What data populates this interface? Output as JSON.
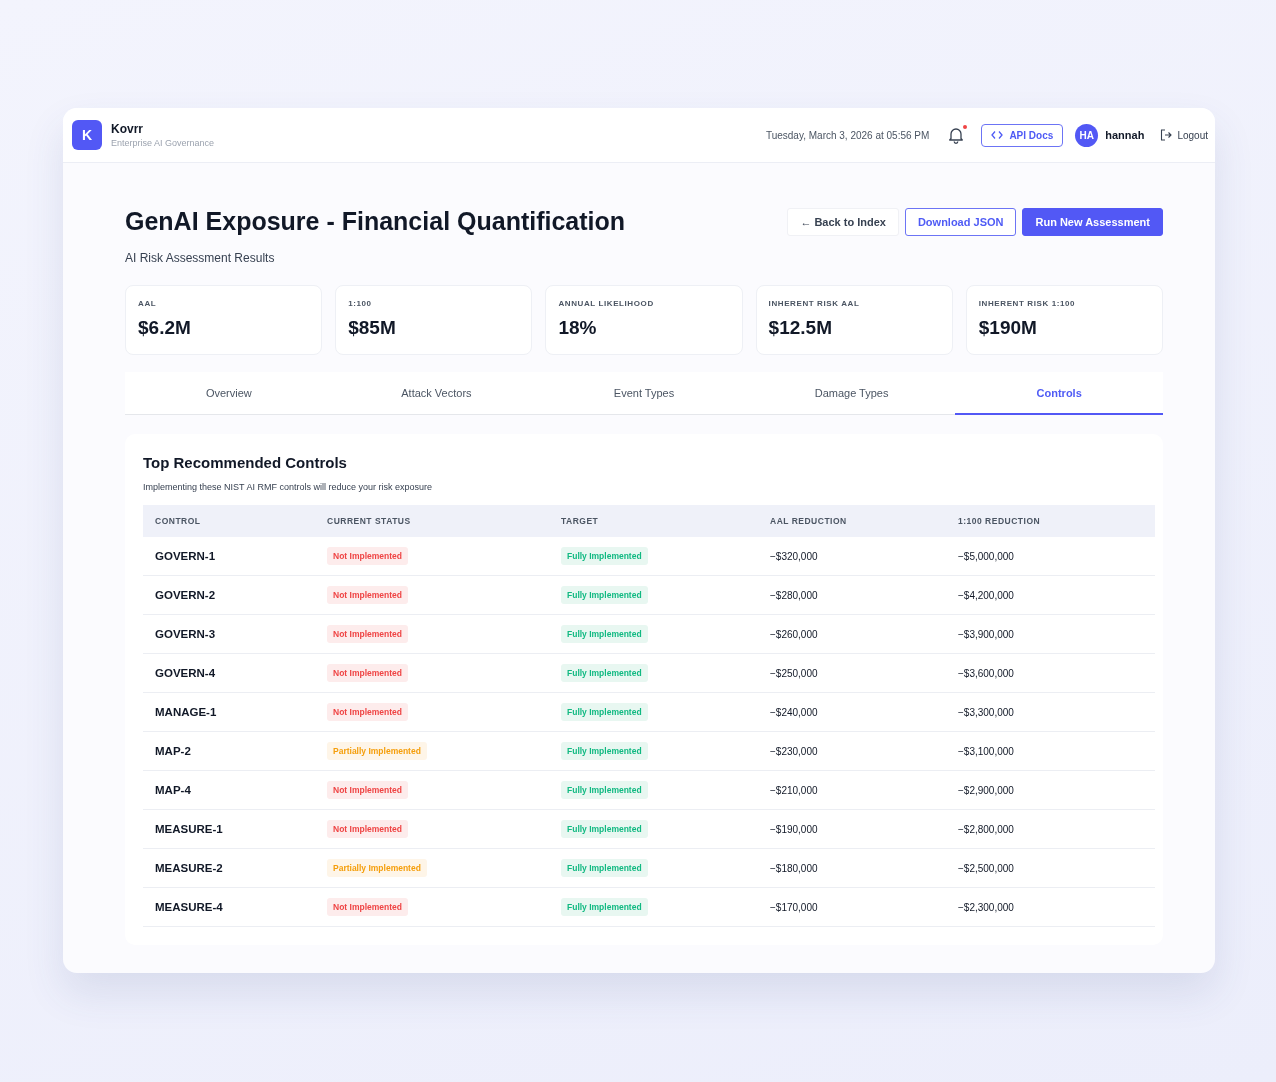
{
  "header": {
    "logo": "K",
    "app_name": "Kovrr",
    "subtitle": "Enterprise AI Governance",
    "datetime": "Tuesday, March 3, 2026 at 05:56 PM",
    "notification_unread": true,
    "api_docs": "API Docs",
    "user_initials": "HA",
    "user_name": "hannah",
    "logout": "Logout"
  },
  "page": {
    "title": "GenAI Exposure - Financial Quantification",
    "subtitle": "AI Risk Assessment Results",
    "buttons": [
      {
        "label": "Back to Index",
        "kind": "back",
        "icon": "←"
      },
      {
        "label": "Download JSON",
        "kind": "outline"
      },
      {
        "label": "Run New Assessment",
        "kind": "primary"
      }
    ]
  },
  "metrics": [
    {
      "label": "AAL",
      "value": "$6.2M"
    },
    {
      "label": "1:100",
      "value": "$85M"
    },
    {
      "label": "ANNUAL LIKELIHOOD",
      "value": "18%"
    },
    {
      "label": "INHERENT RISK AAL",
      "value": "$12.5M"
    },
    {
      "label": "INHERENT RISK 1:100",
      "value": "$190M"
    }
  ],
  "tabs": [
    {
      "label": "Overview",
      "selected": false
    },
    {
      "label": "Attack Vectors",
      "selected": false
    },
    {
      "label": "Event Types",
      "selected": false
    },
    {
      "label": "Damage Types",
      "selected": false
    },
    {
      "label": "Controls",
      "selected": true
    }
  ],
  "controls_panel": {
    "title": "Top Recommended Controls",
    "description": "Implementing these NIST AI RMF controls will reduce your risk exposure",
    "columns": [
      "CONTROL",
      "CURRENT STATUS",
      "TARGET",
      "AAL REDUCTION",
      "1:100 REDUCTION"
    ],
    "rows": [
      {
        "control": "GOVERN-1",
        "status": {
          "label": "Not Implemented",
          "kind": "not"
        },
        "target": {
          "label": "Fully Implemented",
          "kind": "full"
        },
        "aal_reduction": "−$320,000",
        "reduction_1_100": "−$5,000,000"
      },
      {
        "control": "GOVERN-2",
        "status": {
          "label": "Not Implemented",
          "kind": "not"
        },
        "target": {
          "label": "Fully Implemented",
          "kind": "full"
        },
        "aal_reduction": "−$280,000",
        "reduction_1_100": "−$4,200,000"
      },
      {
        "control": "GOVERN-3",
        "status": {
          "label": "Not Implemented",
          "kind": "not"
        },
        "target": {
          "label": "Fully Implemented",
          "kind": "full"
        },
        "aal_reduction": "−$260,000",
        "reduction_1_100": "−$3,900,000"
      },
      {
        "control": "GOVERN-4",
        "status": {
          "label": "Not Implemented",
          "kind": "not"
        },
        "target": {
          "label": "Fully Implemented",
          "kind": "full"
        },
        "aal_reduction": "−$250,000",
        "reduction_1_100": "−$3,600,000"
      },
      {
        "control": "MANAGE-1",
        "status": {
          "label": "Not Implemented",
          "kind": "not"
        },
        "target": {
          "label": "Fully Implemented",
          "kind": "full"
        },
        "aal_reduction": "−$240,000",
        "reduction_1_100": "−$3,300,000"
      },
      {
        "control": "MAP-2",
        "status": {
          "label": "Partially Implemented",
          "kind": "partial"
        },
        "target": {
          "label": "Fully Implemented",
          "kind": "full"
        },
        "aal_reduction": "−$230,000",
        "reduction_1_100": "−$3,100,000"
      },
      {
        "control": "MAP-4",
        "status": {
          "label": "Not Implemented",
          "kind": "not"
        },
        "target": {
          "label": "Fully Implemented",
          "kind": "full"
        },
        "aal_reduction": "−$210,000",
        "reduction_1_100": "−$2,900,000"
      },
      {
        "control": "MEASURE-1",
        "status": {
          "label": "Not Implemented",
          "kind": "not"
        },
        "target": {
          "label": "Fully Implemented",
          "kind": "full"
        },
        "aal_reduction": "−$190,000",
        "reduction_1_100": "−$2,800,000"
      },
      {
        "control": "MEASURE-2",
        "status": {
          "label": "Partially Implemented",
          "kind": "partial"
        },
        "target": {
          "label": "Fully Implemented",
          "kind": "full"
        },
        "aal_reduction": "−$180,000",
        "reduction_1_100": "−$2,500,000"
      },
      {
        "control": "MEASURE-4",
        "status": {
          "label": "Not Implemented",
          "kind": "not"
        },
        "target": {
          "label": "Fully Implemented",
          "kind": "full"
        },
        "aal_reduction": "−$170,000",
        "reduction_1_100": "−$2,300,000"
      }
    ]
  }
}
